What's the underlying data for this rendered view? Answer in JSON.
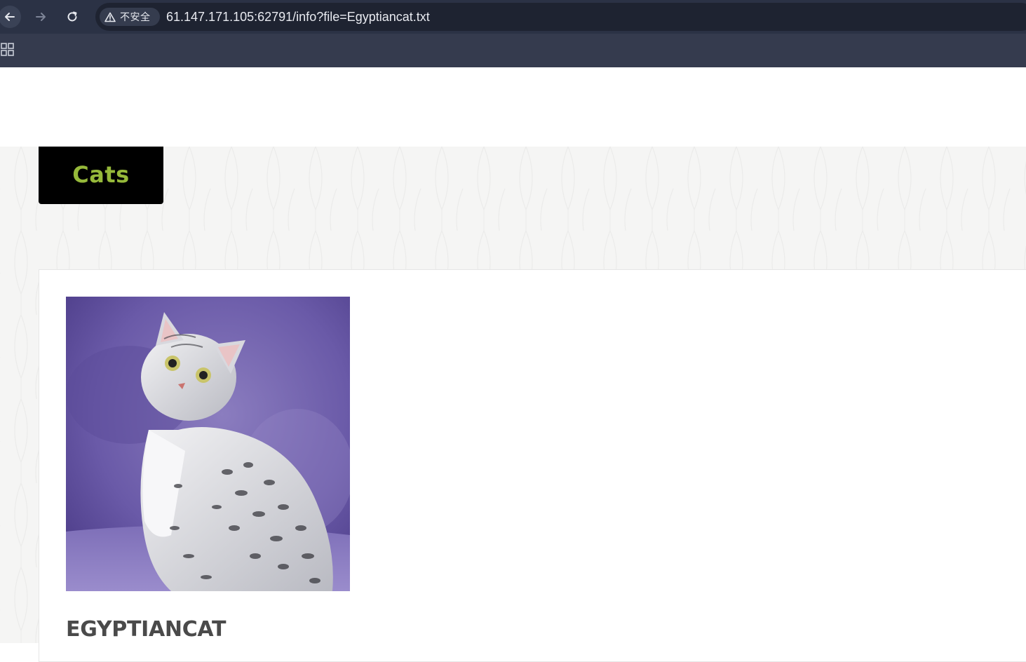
{
  "browser": {
    "address_bar": {
      "security_label": "不安全",
      "url": "61.147.171.105:62791/info?file=Egyptiancat.txt"
    },
    "icons": {
      "back": "arrow-left-icon",
      "forward": "arrow-right-icon",
      "reload": "reload-icon",
      "security": "warning-triangle-icon",
      "apps": "apps-grid-icon"
    }
  },
  "site": {
    "logo_text": "Cats",
    "accent_color": "#96b93a"
  },
  "cat": {
    "name": "EGYPTIANCAT",
    "photo": "egyptian-mau-cat-photo"
  }
}
